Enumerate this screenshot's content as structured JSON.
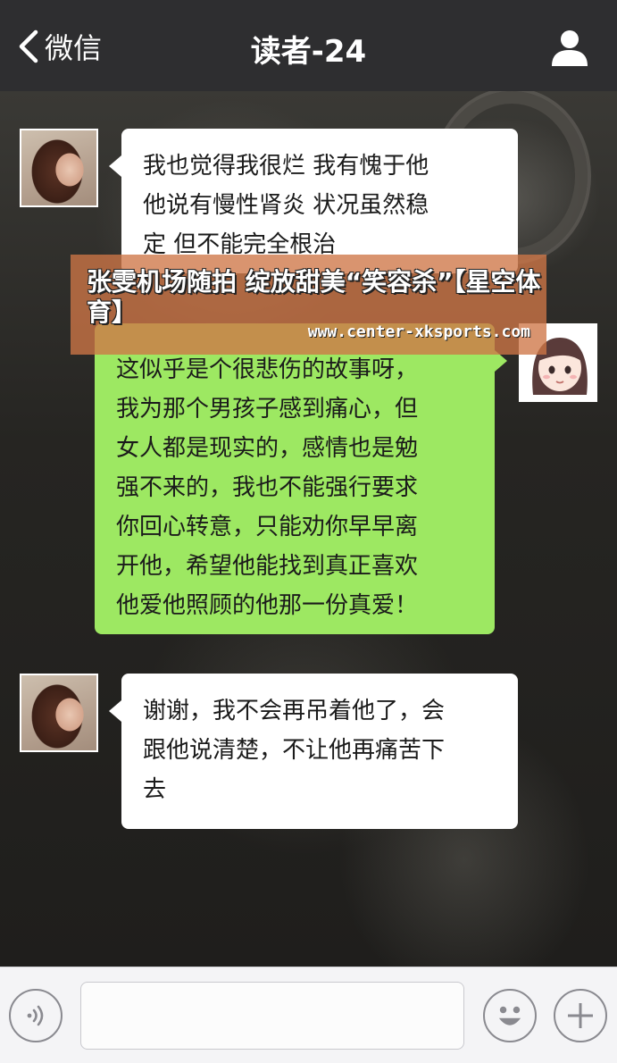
{
  "nav": {
    "back_label": "微信",
    "title": "读者-24"
  },
  "messages": [
    {
      "sender": "her",
      "lines": [
        "我也觉得我很烂 我有愧于他",
        "他说有慢性肾炎 状况虽然稳",
        "定 但不能完全根治"
      ]
    },
    {
      "sender": "me",
      "lines": [
        "这似乎是个很悲伤的故事呀，",
        "我为那个男孩子感到痛心，但",
        "女人都是现实的，感情也是勉",
        "强不来的，我也不能强行要求",
        "你回心转意，只能劝你早早离",
        "开他，希望他能找到真正喜欢",
        "他爱他照顾的他那一份真爱！"
      ]
    },
    {
      "sender": "her",
      "lines": [
        "谢谢，我不会再吊着他了，会",
        "跟他说清楚，不让他再痛苦下",
        "去"
      ]
    }
  ],
  "banner": {
    "headline": "张雯机场随拍 绽放甜美“笑容杀”【星空体育】",
    "url": "www.center-xksports.com"
  },
  "inputbar": {
    "voice_icon": "voice-icon",
    "emoji_icon": "emoji-icon",
    "plus_icon": "plus-icon",
    "text_value": ""
  },
  "colors": {
    "navbar": "#2e2e30",
    "bubble_incoming": "#ffffff",
    "bubble_outgoing": "#9de862",
    "banner": "#ce7646",
    "inputbar": "#f4f4f6"
  }
}
